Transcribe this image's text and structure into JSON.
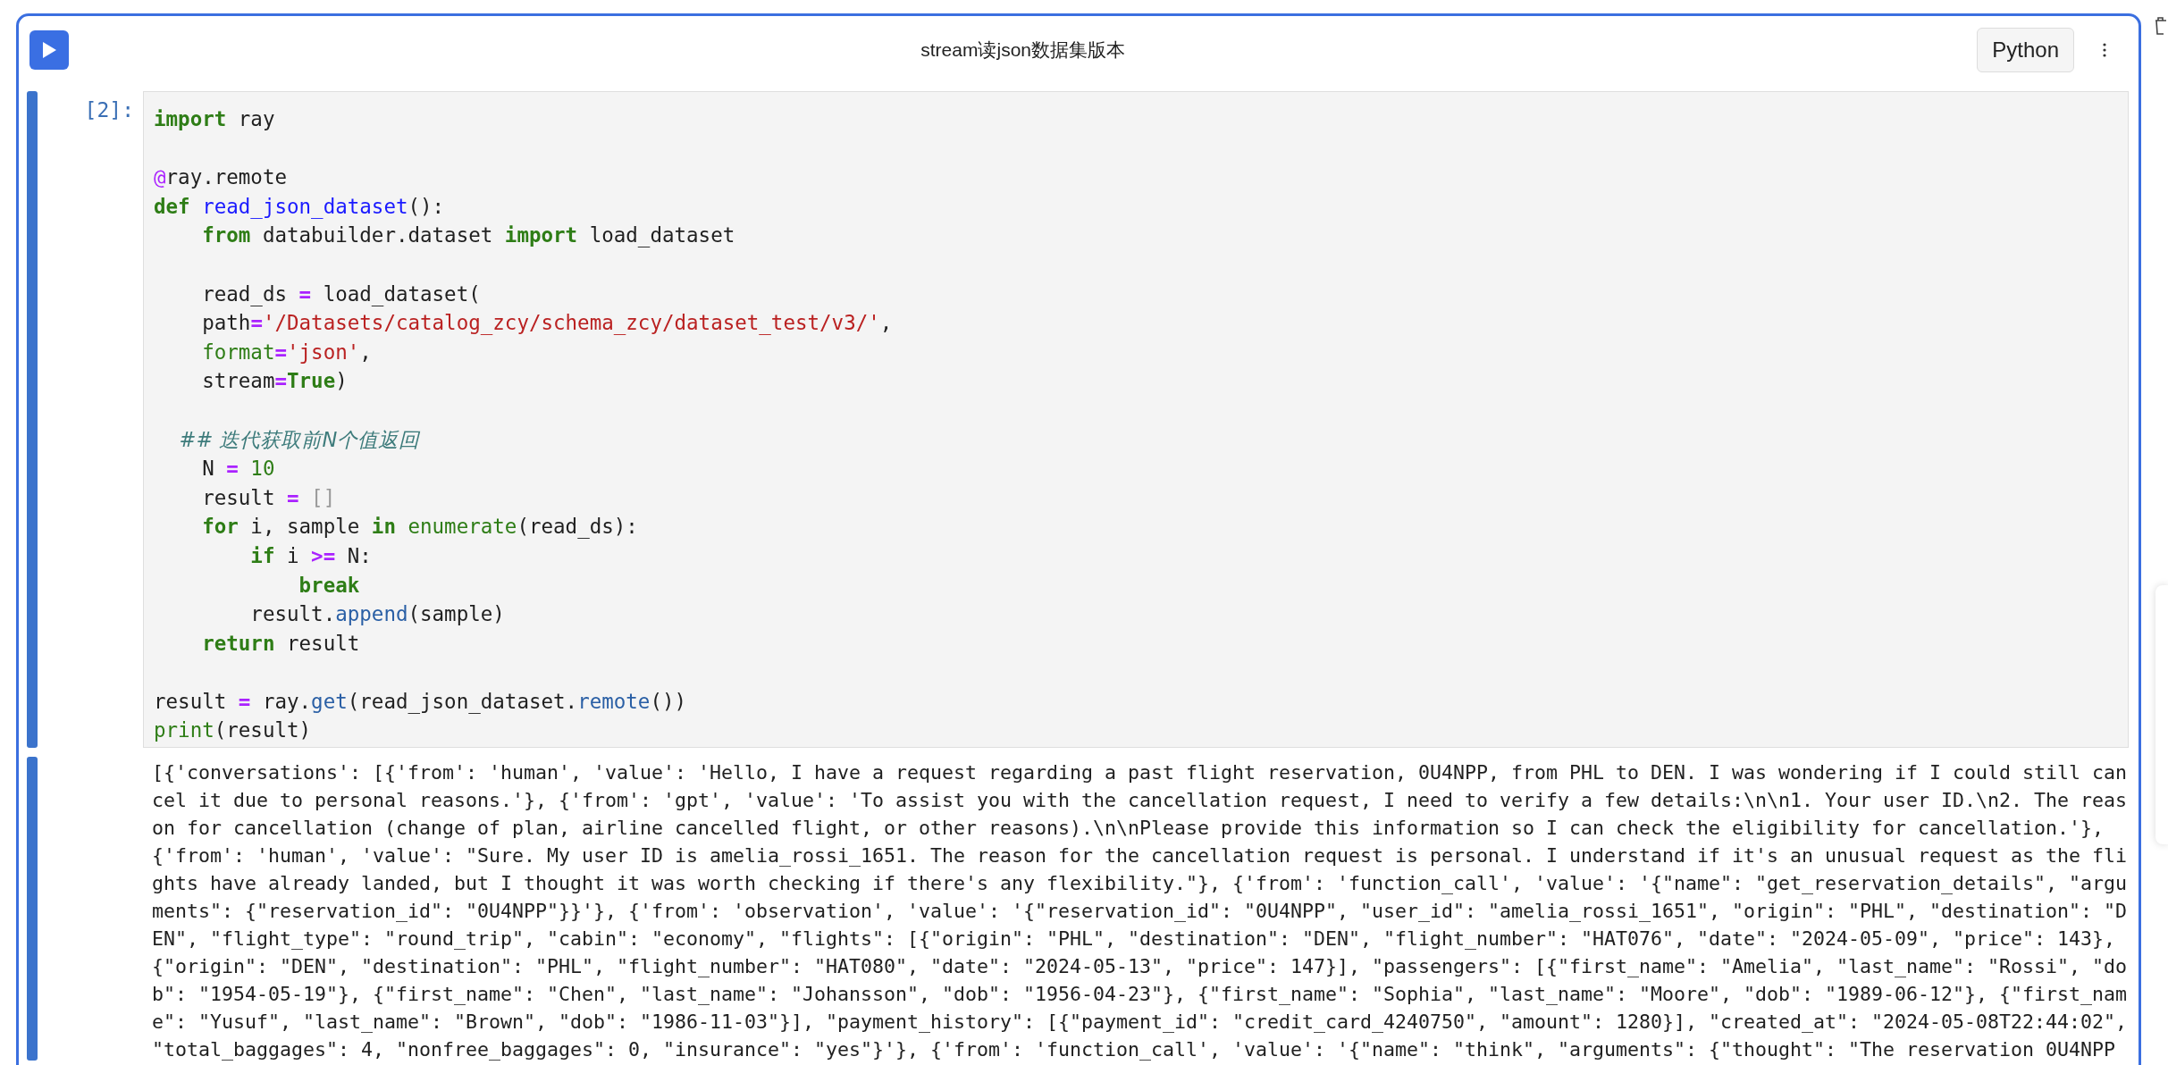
{
  "cell": {
    "title": "stream读json数据集版本",
    "language": "Python",
    "prompt": "[2]:",
    "code": [
      {
        "gap_before": false,
        "tokens": [
          {
            "kind": "kw",
            "text": "import"
          },
          {
            "kind": "plain",
            "text": " ray"
          }
        ]
      },
      {
        "gap_before": true,
        "tokens": [
          {
            "kind": "deco",
            "text": "@"
          },
          {
            "kind": "plain",
            "text": "ray.remote"
          }
        ]
      },
      {
        "gap_before": false,
        "tokens": [
          {
            "kind": "kw",
            "text": "def"
          },
          {
            "kind": "def",
            "text": " read_json_dataset"
          },
          {
            "kind": "plain",
            "text": "():"
          }
        ]
      },
      {
        "gap_before": false,
        "tokens": [
          {
            "kind": "kw",
            "text": "    from"
          },
          {
            "kind": "plain",
            "text": " databuilder.dataset "
          },
          {
            "kind": "kw",
            "text": "import"
          },
          {
            "kind": "plain",
            "text": " load_dataset"
          }
        ]
      },
      {
        "gap_before": true,
        "tokens": [
          {
            "kind": "plain",
            "text": "    read_ds "
          },
          {
            "kind": "op",
            "text": "="
          },
          {
            "kind": "plain",
            "text": " load_dataset("
          }
        ]
      },
      {
        "gap_before": false,
        "tokens": [
          {
            "kind": "plain",
            "text": "    path"
          },
          {
            "kind": "op",
            "text": "="
          },
          {
            "kind": "str",
            "text": "'/Datasets/catalog_zcy/schema_zcy/dataset_test/v3/'"
          },
          {
            "kind": "plain",
            "text": ","
          }
        ]
      },
      {
        "gap_before": false,
        "tokens": [
          {
            "kind": "builtin",
            "text": "    format"
          },
          {
            "kind": "op",
            "text": "="
          },
          {
            "kind": "str",
            "text": "'json'"
          },
          {
            "kind": "plain",
            "text": ","
          }
        ]
      },
      {
        "gap_before": false,
        "tokens": [
          {
            "kind": "plain",
            "text": "    stream"
          },
          {
            "kind": "op",
            "text": "="
          },
          {
            "kind": "kw",
            "text": "True"
          },
          {
            "kind": "plain",
            "text": ")"
          }
        ]
      },
      {
        "gap_before": true,
        "tokens": [
          {
            "kind": "comment",
            "text": "    ## 迭代获取前N个值返回"
          }
        ]
      },
      {
        "gap_before": false,
        "tokens": [
          {
            "kind": "plain",
            "text": "    N "
          },
          {
            "kind": "op",
            "text": "="
          },
          {
            "kind": "num",
            "text": " 10"
          }
        ]
      },
      {
        "gap_before": false,
        "tokens": [
          {
            "kind": "plain",
            "text": "    result "
          },
          {
            "kind": "op",
            "text": "="
          },
          {
            "kind": "dim",
            "text": " []"
          }
        ]
      },
      {
        "gap_before": false,
        "tokens": [
          {
            "kind": "kw",
            "text": "    for"
          },
          {
            "kind": "plain",
            "text": " i, sample "
          },
          {
            "kind": "kw",
            "text": "in"
          },
          {
            "kind": "builtin",
            "text": " enumerate"
          },
          {
            "kind": "plain",
            "text": "(read_ds):"
          }
        ]
      },
      {
        "gap_before": false,
        "tokens": [
          {
            "kind": "kw",
            "text": "        if"
          },
          {
            "kind": "plain",
            "text": " i "
          },
          {
            "kind": "op",
            "text": ">="
          },
          {
            "kind": "plain",
            "text": " N:"
          }
        ]
      },
      {
        "gap_before": false,
        "tokens": [
          {
            "kind": "kw",
            "text": "            break"
          }
        ]
      },
      {
        "gap_before": false,
        "tokens": [
          {
            "kind": "plain",
            "text": "        result."
          },
          {
            "kind": "method",
            "text": "append"
          },
          {
            "kind": "plain",
            "text": "(sample)"
          }
        ]
      },
      {
        "gap_before": false,
        "tokens": [
          {
            "kind": "kw",
            "text": "    return"
          },
          {
            "kind": "plain",
            "text": " result"
          }
        ]
      },
      {
        "gap_before": true,
        "tokens": [
          {
            "kind": "plain",
            "text": "result "
          },
          {
            "kind": "op",
            "text": "="
          },
          {
            "kind": "plain",
            "text": " ray."
          },
          {
            "kind": "method",
            "text": "get"
          },
          {
            "kind": "plain",
            "text": "(read_json_dataset."
          },
          {
            "kind": "method",
            "text": "remote"
          },
          {
            "kind": "plain",
            "text": "())"
          }
        ]
      },
      {
        "gap_before": false,
        "tokens": [
          {
            "kind": "builtin",
            "text": "print"
          },
          {
            "kind": "plain",
            "text": "(result)"
          }
        ]
      }
    ],
    "output": [
      "[{'conversations': [{'from': 'human', 'value': 'Hello, I have a request regarding a past flight reservation, 0U4NPP, from PHL to DEN. I was wondering if I could still can",
      "cel it due to personal reasons.'}, {'from': 'gpt', 'value': 'To assist you with the cancellation request, I need to verify a few details:\\n\\n1. Your user ID.\\n2. The reas",
      "on for cancellation (change of plan, airline cancelled flight, or other reasons).\\n\\nPlease provide this information so I can check the eligibility for cancellation.'},",
      "{'from': 'human', 'value': \"Sure. My user ID is amelia_rossi_1651. The reason for the cancellation request is personal. I understand if it's an unusual request as the fli",
      "ghts have already landed, but I thought it was worth checking if there's any flexibility.\"}, {'from': 'function_call', 'value': '{\"name\": \"get_reservation_details\", \"argu",
      "ments\": {\"reservation_id\": \"0U4NPP\"}}'}, {'from': 'observation', 'value': '{\"reservation_id\": \"0U4NPP\", \"user_id\": \"amelia_rossi_1651\", \"origin\": \"PHL\", \"destination\": \"D",
      "EN\", \"flight_type\": \"round_trip\", \"cabin\": \"economy\", \"flights\": [{\"origin\": \"PHL\", \"destination\": \"DEN\", \"flight_number\": \"HAT076\", \"date\": \"2024-05-09\", \"price\": 143},",
      "{\"origin\": \"DEN\", \"destination\": \"PHL\", \"flight_number\": \"HAT080\", \"date\": \"2024-05-13\", \"price\": 147}], \"passengers\": [{\"first_name\": \"Amelia\", \"last_name\": \"Rossi\", \"do",
      "b\": \"1954-05-19\"}, {\"first_name\": \"Chen\", \"last_name\": \"Johansson\", \"dob\": \"1956-04-23\"}, {\"first_name\": \"Sophia\", \"last_name\": \"Moore\", \"dob\": \"1989-06-12\"}, {\"first_nam",
      "e\": \"Yusuf\", \"last_name\": \"Brown\", \"dob\": \"1986-11-03\"}], \"payment_history\": [{\"payment_id\": \"credit_card_4240750\", \"amount\": 1280}], \"created_at\": \"2024-05-08T22:44:02\",",
      "\"total_baggages\": 4, \"nonfree_baggages\": 0, \"insurance\": \"yes\"}'}, {'from': 'function_call', 'value': '{\"name\": \"think\", \"arguments\": {\"thought\": \"The reservation 0U4NPP"
    ]
  }
}
